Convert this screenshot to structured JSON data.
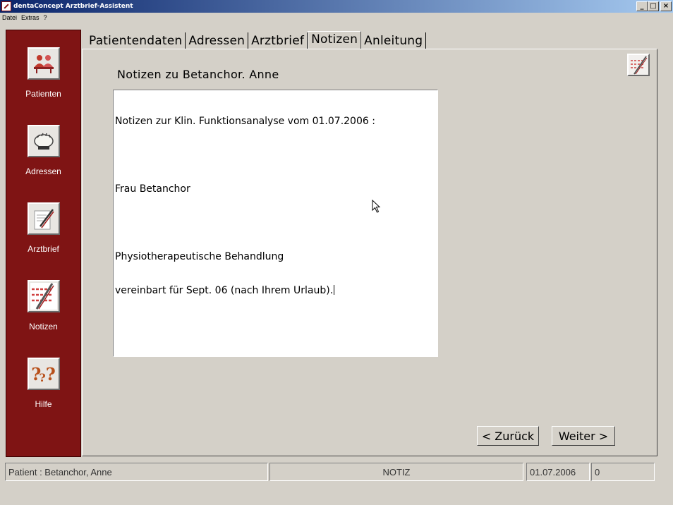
{
  "window": {
    "title": "dentaConcept Arztbrief-Assistent",
    "controls": [
      "_",
      "□",
      "×"
    ]
  },
  "menu": [
    "Datei",
    "Extras",
    "?"
  ],
  "sidebar": {
    "items": [
      {
        "label": "Patienten",
        "icon": "patients-icon"
      },
      {
        "label": "Adressen",
        "icon": "rolodex-icon"
      },
      {
        "label": "Arztbrief",
        "icon": "letter-pen-icon"
      },
      {
        "label": "Notizen",
        "icon": "notes-icon"
      },
      {
        "label": "Hilfe",
        "icon": "help-icon"
      }
    ]
  },
  "tabs": [
    {
      "label": "Patientendaten",
      "active": false
    },
    {
      "label": "Adressen",
      "active": false
    },
    {
      "label": "Arztbrief",
      "active": false
    },
    {
      "label": "Notizen",
      "active": true
    },
    {
      "label": "Anleitung",
      "active": false
    }
  ],
  "notes": {
    "title": "Notizen zu Betanchor. Anne",
    "lines": [
      "Notizen zur Klin. Funktionsanalyse vom 01.07.2006 :",
      "",
      "Frau Betanchor",
      "",
      "Physiotherapeutische Behandlung",
      "vereinbart für Sept. 06 (nach Ihrem Urlaub)."
    ]
  },
  "buttons": {
    "back_label": "< Zurück",
    "next_label": "Weiter >"
  },
  "status": {
    "patient": "Patient : Betanchor, Anne",
    "mode": "NOTIZ",
    "date": "01.07.2006",
    "count": "0"
  },
  "colors": {
    "sidebar": "#7f1414",
    "window_bg": "#d4d0c8",
    "titlebar_start": "#0a246a",
    "titlebar_end": "#a6caf0"
  }
}
